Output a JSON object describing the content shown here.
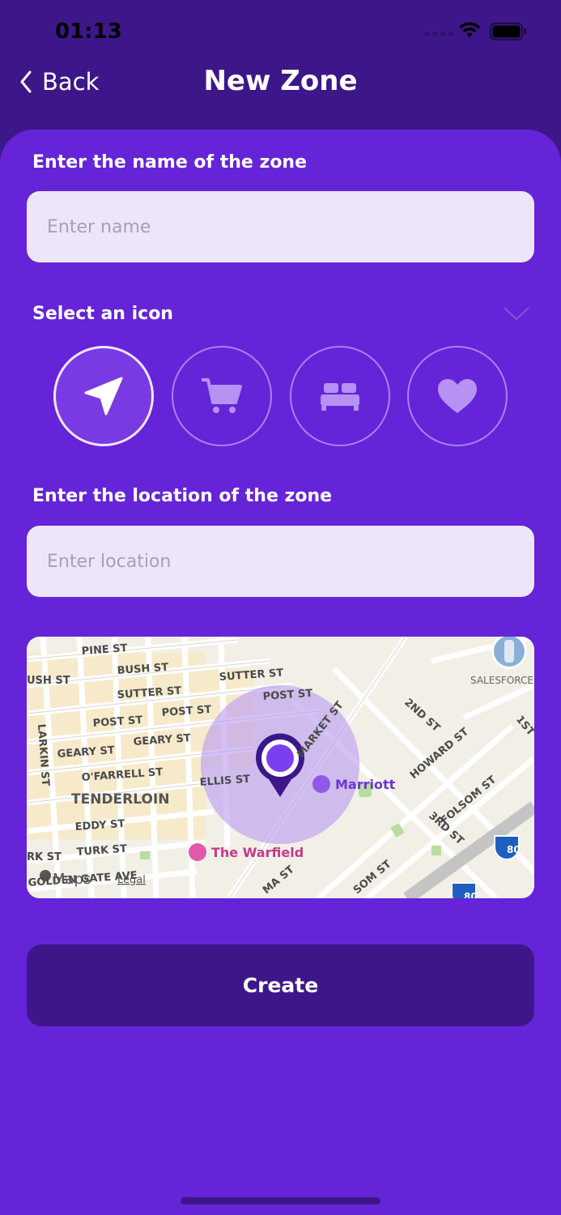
{
  "status": {
    "time": "01:13"
  },
  "nav": {
    "back_label": "Back",
    "title": "New Zone"
  },
  "form": {
    "name_label": "Enter the name of the zone",
    "name_placeholder": "Enter name",
    "name_value": "",
    "icon_label": "Select an icon",
    "icons": [
      {
        "name": "navigation-arrow-icon",
        "selected": true
      },
      {
        "name": "shopping-cart-icon",
        "selected": false
      },
      {
        "name": "bed-icon",
        "selected": false
      },
      {
        "name": "heart-icon",
        "selected": false
      }
    ],
    "location_label": "Enter the location of the zone",
    "location_placeholder": "Enter location",
    "location_value": ""
  },
  "map": {
    "streets": [
      "PINE ST",
      "BUSH ST",
      "SUTTER ST",
      "SUTTER ST",
      "POST ST",
      "POST ST",
      "POST ST",
      "GEARY ST",
      "GEARY ST",
      "O'FARRELL ST",
      "ELLIS ST",
      "EDDY ST",
      "TURK ST",
      "GOLDEN GATE AVE",
      "LARKIN ST",
      "MARKET ST",
      "2ND ST",
      "HOWARD ST",
      "FOLSOM ST",
      "3RD ST",
      "1ST",
      "SOM ST",
      "MA ST",
      "USH ST",
      "RK ST"
    ],
    "neighborhood": "TENDERLOIN",
    "pois": [
      "Marriott",
      "The Warfield",
      "SALESFORCE TOWER"
    ],
    "highway_shields": [
      "80",
      "80"
    ],
    "attribution": "Maps",
    "legal": "Legal"
  },
  "actions": {
    "create_label": "Create"
  },
  "colors": {
    "header_bg": "#3d178a",
    "card_bg": "#6524d8",
    "field_bg": "#ede6fb",
    "accent": "#7b3ff2",
    "button_bg": "#3d178a"
  }
}
